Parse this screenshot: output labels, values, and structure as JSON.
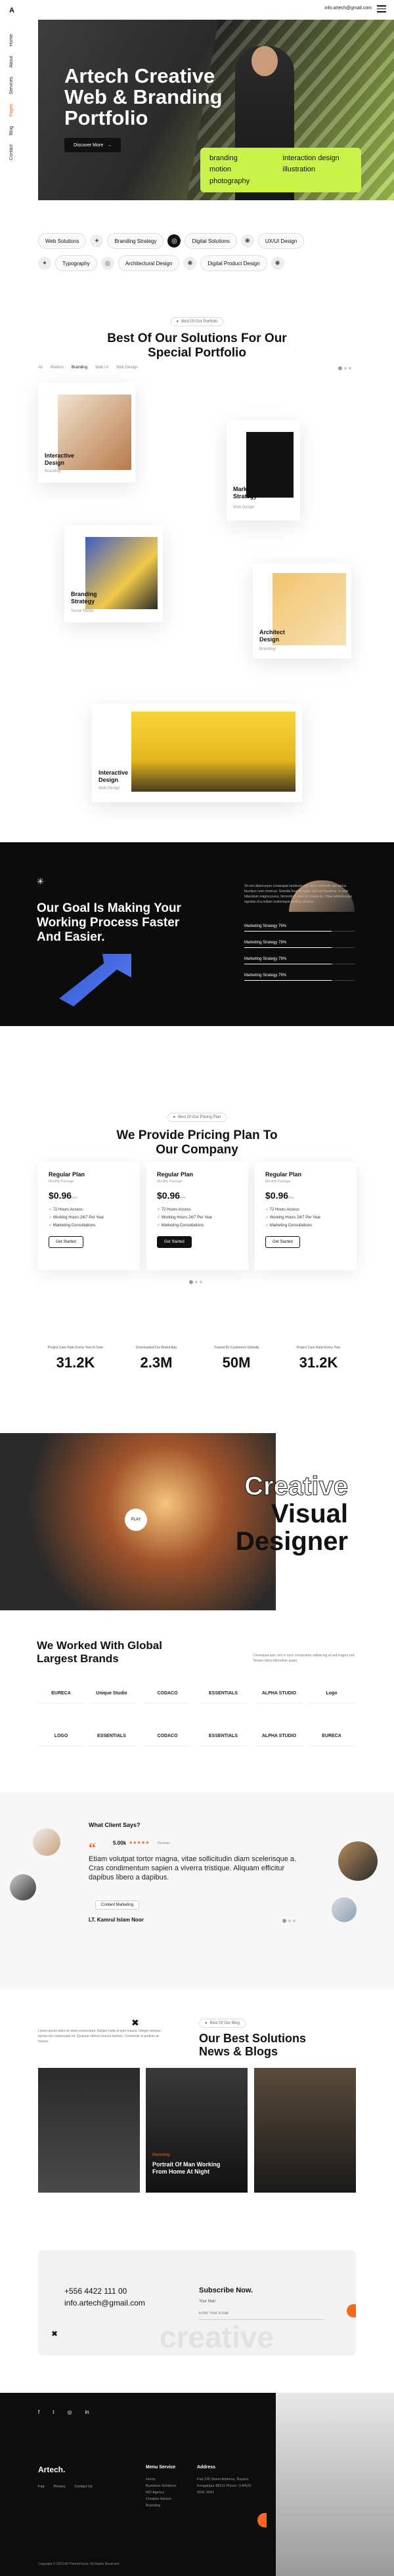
{
  "brand": {
    "logo": "A"
  },
  "sidebar": {
    "items": [
      "Home",
      "About",
      "Services",
      "Pages",
      "Blog",
      "Contact"
    ],
    "active_index": 3
  },
  "header": {
    "email": "info.artech@gmail.com"
  },
  "hero": {
    "title_line1": "Artech Creative",
    "title_line2": "Web & Branding",
    "title_line3": "Portfolio",
    "button_label": "Discover More",
    "tags": [
      "branding",
      "interaction design",
      "motion",
      "illustration",
      "photography",
      ""
    ]
  },
  "services": {
    "row1": [
      "Web Solutions",
      "Branding Strategy",
      "Digital Solutions",
      "UX/UI Design"
    ],
    "row2": [
      "Typography",
      "Architectural Design",
      "Digital Product Design"
    ]
  },
  "portfolio": {
    "chip": "Best Of Our Portfolio",
    "heading_line1": "Best Of Our Solutions For Our",
    "heading_line2": "Special Portfolio",
    "filters": [
      "All",
      "Modern",
      "Branding",
      "Web UI",
      "Web Design"
    ],
    "active_filter": 2,
    "items": [
      {
        "title": "Interactive Design",
        "category": "Branding"
      },
      {
        "title": "Marketing Strategy",
        "category": "Web Design"
      },
      {
        "title": "Branding Strategy",
        "category": "Social Media"
      },
      {
        "title": "Architect Design",
        "category": "Branding"
      },
      {
        "title": "Interactive Design",
        "category": "Web Design"
      }
    ]
  },
  "goal": {
    "heading_line1": "Our Goal Is Making Your",
    "heading_line2": "Working Process Faster",
    "heading_line3": "And Easier.",
    "paragraph": "Sit nisl ullamcorper consequat hendrerit sed. Nunc molestie nisi varius faucibus nunc rhoncus. Gravida feugiat mattis sed sed faucibus. In ante bibendum magna purus, fermentum vitae sit massa ac. Vitae pellentesque egestas id a nullam scelerisque facilisis ultricies.",
    "bars": [
      {
        "label": "Marketing Strategy 79%",
        "value": 79
      },
      {
        "label": "Marketing Strategy 79%",
        "value": 79
      },
      {
        "label": "Marketing Strategy 79%",
        "value": 79
      },
      {
        "label": "Marketing Strategy 79%",
        "value": 79
      }
    ]
  },
  "pricing": {
    "chip": "Best Of Our Pricing Plan",
    "heading_line1": "We Provide Pricing Plan To",
    "heading_line2": "Our Company",
    "plans": [
      {
        "title": "Regular Plan",
        "subtitle": "Monthly Package",
        "price": "$0.96",
        "per": "/mo",
        "features": [
          "72 Hours Access",
          "Working Hours 24/7 Per Year",
          "Marketing Consultations"
        ],
        "cta": "Get Started"
      },
      {
        "title": "Regular Plan",
        "subtitle": "Monthly Package",
        "price": "$0.96",
        "per": "/mo",
        "features": [
          "72 Hours Access",
          "Working Hours 24/7 Per Year",
          "Marketing Consultations"
        ],
        "cta": "Get Started"
      },
      {
        "title": "Regular Plan",
        "subtitle": "Monthly Package",
        "price": "$0.96",
        "per": "/mo",
        "features": [
          "72 Hours Access",
          "Working Hours 24/7 Per Year",
          "Marketing Consultations"
        ],
        "cta": "Get Started"
      }
    ]
  },
  "stats": [
    {
      "label": "Project Care Ratio Every Year In Over",
      "value": "31.2K"
    },
    {
      "label": "Downloaded Our Brand App",
      "value": "2.3M"
    },
    {
      "label": "Trusted By Customers Globally",
      "value": "50M"
    },
    {
      "label": "Project Care Ratio Every Year",
      "value": "31.2K"
    }
  ],
  "creative": {
    "line1": "Creative",
    "line2": "Visual",
    "line3": "Designer",
    "play": "PLAY"
  },
  "brands": {
    "heading_line1": "We Worked With Global",
    "heading_line2": "Largest Brands",
    "text": "Consequat quis, nisl in nunc consectetur adipiscing at sed magna sed. Tempor tellus bibendum quam.",
    "row1": [
      "EURECA",
      "Unique Studio",
      "CODACO",
      "ESSENTIALS",
      "ALPHA STUDIO",
      "Logo"
    ],
    "row2": [
      "LOGO",
      "ESSENTIALS",
      "CODACO",
      "ESSENTIALS",
      "ALPHA STUDIO",
      "EURECA"
    ]
  },
  "testimonial": {
    "heading": "What Client Says?",
    "rating": "5.00k",
    "rating_sub": "Reviews",
    "quote": "Etiam volutpat tortor magna, vitae sollicitudin diam scelerisque a. Cras condimentum sapien a viverra tristique. Aliquam efficitur dapibus libero a dapibus.",
    "role": "Content Marketing",
    "name": "LT. Kamrul Islam Noor"
  },
  "blog": {
    "chip": "Best Of Our Blog",
    "heading_line1": "Our Best Solutions",
    "heading_line2": "News & Blogs",
    "intro": "Lorem ipsum dolor sit amet consectetur. Nullam nulla at eget massa. Integer tempus lacinia nec malesuada mi. Quisque ultrices mauris facilisis. Commodo ut pretium ac massa.",
    "post_tag": "Marketing",
    "post_title": "Portrait Of Man Working From Home At Night"
  },
  "contact": {
    "phone": "+556 4422 111 00",
    "email": "info.artech@gmail.com",
    "subscribe": "Subscribe Now.",
    "email_label": "Your Mail",
    "email_placeholder": "Enter Your Email",
    "watermark": "creative"
  },
  "footer": {
    "logo": "Artech.",
    "links": [
      "Faq",
      "Privacy",
      "Contact Us"
    ],
    "menu_title": "Menu Service",
    "menu": [
      "Home",
      "Business Solutions",
      "MO Agency",
      "Creative Advent",
      "Branding"
    ],
    "address_title": "Address",
    "address": "Flat 130 Street Address, Nayara Kongaripur 88111 Phone: (+84)25 5541 3041",
    "copyright": "Copyright © 2023 All ThemeForest. All Rights Reserved"
  }
}
